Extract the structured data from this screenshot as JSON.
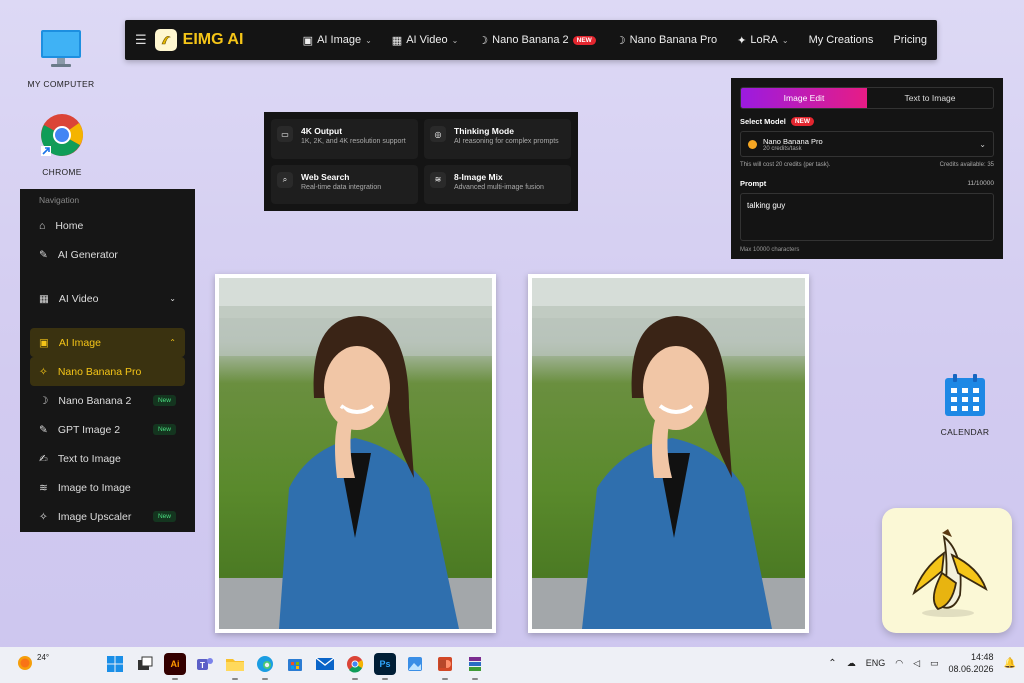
{
  "desktop": {
    "icons": [
      {
        "label": "MY COMPUTER"
      },
      {
        "label": "CHROME"
      },
      {
        "label": "CALENDAR"
      }
    ]
  },
  "topnav": {
    "brand": "EIMG AI",
    "items": [
      {
        "label": "AI Image",
        "dropdown": true
      },
      {
        "label": "AI Video",
        "dropdown": true
      },
      {
        "label": "Nano Banana 2",
        "badge": "NEW"
      },
      {
        "label": "Nano Banana Pro"
      },
      {
        "label": "LoRA",
        "dropdown": true
      },
      {
        "label": "My Creations"
      },
      {
        "label": "Pricing"
      }
    ]
  },
  "features": [
    {
      "title": "4K Output",
      "desc": "1K, 2K, and 4K resolution support"
    },
    {
      "title": "Thinking Mode",
      "desc": "AI reasoning for complex prompts"
    },
    {
      "title": "Web Search",
      "desc": "Real-time data integration"
    },
    {
      "title": "8-Image Mix",
      "desc": "Advanced multi-image fusion"
    }
  ],
  "sidebar": {
    "heading": "Navigation",
    "items": [
      {
        "label": "Home"
      },
      {
        "label": "AI Generator"
      },
      {
        "label": "AI Video"
      },
      {
        "label": "AI Image"
      },
      {
        "label": "Nano Banana Pro"
      },
      {
        "label": "Nano Banana 2",
        "tag": "New"
      },
      {
        "label": "GPT Image 2",
        "tag": "New"
      },
      {
        "label": "Text to Image"
      },
      {
        "label": "Image to Image"
      },
      {
        "label": "Image Upscaler",
        "tag": "New"
      }
    ]
  },
  "editor": {
    "tab_edit": "Image Edit",
    "tab_t2i": "Text to Image",
    "select_model_label": "Select Model",
    "select_model_badge": "NEW",
    "model_name": "Nano Banana Pro",
    "model_cost": "20 credits/task",
    "cost_note": "This will cost 20 credits (per task).",
    "credits_available": "Credits available: 35",
    "prompt_label": "Prompt",
    "prompt_count": "11/10000",
    "prompt_value": "talking guy",
    "max_chars": "Max 10000 characters"
  },
  "taskbar": {
    "weather": "24°",
    "language": "ENG",
    "time": "14:48",
    "date": "08.06.2026",
    "apps": [
      {
        "name": "start-icon"
      },
      {
        "name": "task-view-icon"
      },
      {
        "name": "illustrator-icon",
        "text": "Ai"
      },
      {
        "name": "teams-icon"
      },
      {
        "name": "file-explorer-icon"
      },
      {
        "name": "edge-icon"
      },
      {
        "name": "store-icon"
      },
      {
        "name": "mail-icon"
      },
      {
        "name": "chrome-icon"
      },
      {
        "name": "photoshop-icon",
        "text": "Ps"
      },
      {
        "name": "photos-icon"
      },
      {
        "name": "powerpoint-icon"
      },
      {
        "name": "winrar-icon"
      }
    ]
  }
}
